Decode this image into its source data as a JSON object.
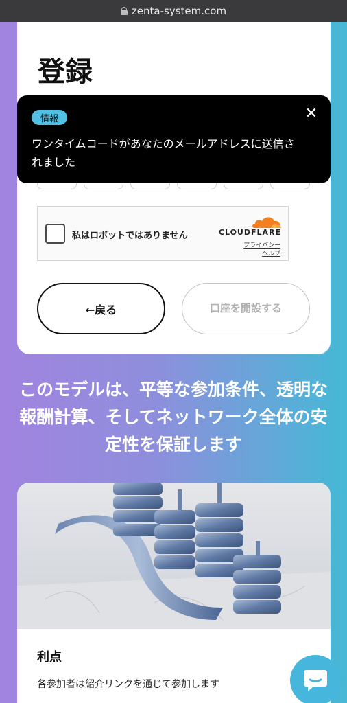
{
  "browser": {
    "url": "zenta-system.com"
  },
  "form": {
    "title": "登録",
    "captcha": {
      "label": "私はロボットではありません",
      "brand": "CLOUDFLARE",
      "privacy": "プライバシー",
      "help": "ヘルプ"
    },
    "back_button": "←戻る",
    "open_account_button": "口座を開設する"
  },
  "toast": {
    "badge": "情報",
    "message": "ワンタイムコードがあなたのメールアドレスに送信されました",
    "close_icon": "close-icon"
  },
  "tagline": "このモデルは、平等な参加条件、透明な報酬計算、そしてネットワーク全体の安定性を保証します",
  "feature": {
    "title": "利点",
    "description": "各参加者は紹介リンクを通じて参加します"
  },
  "icons": [
    "lock-icon",
    "close-icon",
    "cloudflare-icon",
    "chat-icon"
  ],
  "colors": {
    "accent": "#52bfe3",
    "chat": "#47b6dd",
    "cloudflare": "#f38020"
  }
}
